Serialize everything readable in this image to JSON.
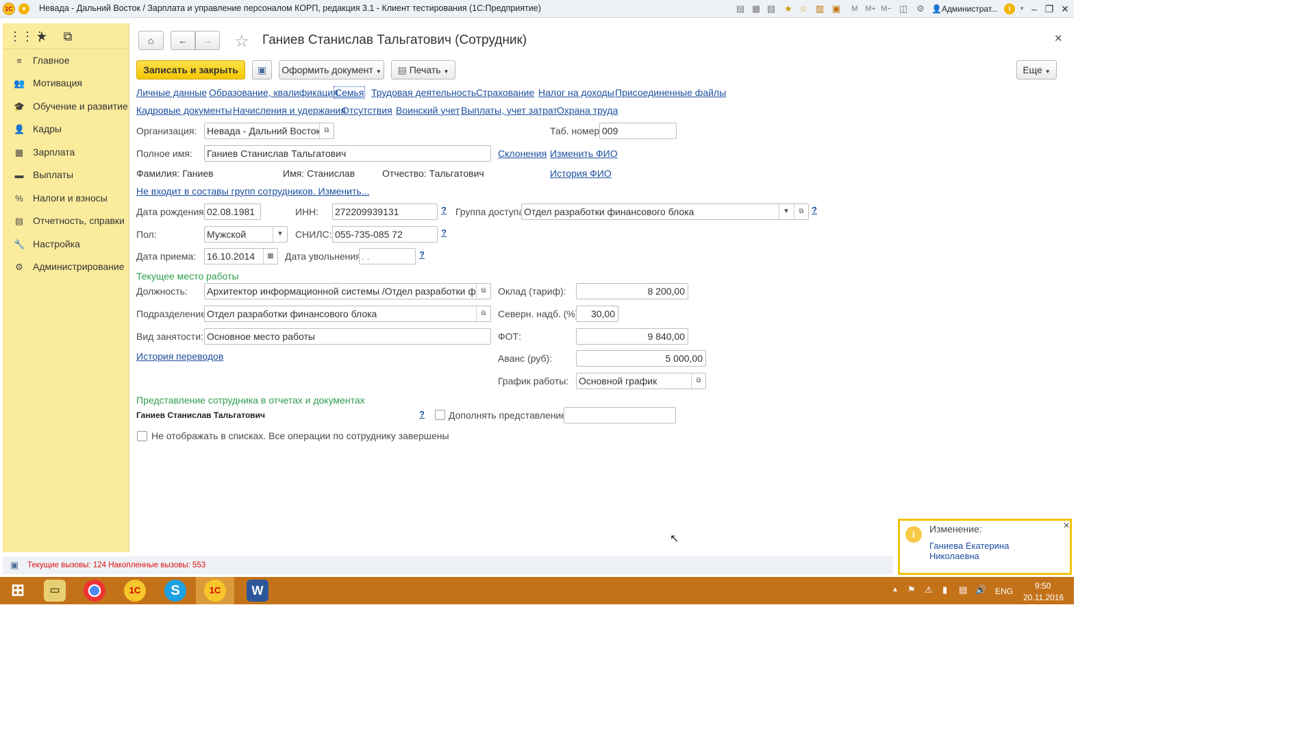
{
  "app": {
    "window_title": "Невада - Дальний Восток / Зарплата и управление персоналом КОРП, редакция 3.1  - Клиент тестирования (1С:Предприятие)",
    "user": "Администрат...",
    "logo": "1С"
  },
  "sidebar": {
    "items": [
      {
        "label": "Главное",
        "icon": "menu-lines-icon"
      },
      {
        "label": "Мотивация",
        "icon": "people-icon"
      },
      {
        "label": "Обучение и развитие",
        "icon": "graduation-icon"
      },
      {
        "label": "Кадры",
        "icon": "person-icon"
      },
      {
        "label": "Зарплата",
        "icon": "calculator-icon"
      },
      {
        "label": "Выплаты",
        "icon": "card-icon"
      },
      {
        "label": "Налоги и взносы",
        "icon": "percent-icon"
      },
      {
        "label": "Отчетность, справки",
        "icon": "report-icon"
      },
      {
        "label": "Настройка",
        "icon": "wrench-icon"
      },
      {
        "label": "Администрирование",
        "icon": "gear-icon"
      }
    ]
  },
  "form": {
    "title": "Ганиев Станислав Тальгатович (Сотрудник)",
    "toolbar": {
      "save_close": "Записать и закрыть",
      "make_document": "Оформить документ",
      "print": "Печать",
      "more": "Еще"
    },
    "tabs_row1": [
      "Личные данные",
      "Образование, квалификация",
      "Семья",
      "Трудовая деятельность",
      "Страхование",
      "Налог на доходы",
      "Присоединенные файлы"
    ],
    "tabs_row2": [
      "Кадровые документы",
      "Начисления и удержания",
      "Отсутствия",
      "Воинский учет",
      "Выплаты, учет затрат",
      "Охрана труда"
    ],
    "org_label": "Организация:",
    "org_value": "Невада - Дальний Восток",
    "tab_number_label": "Таб. номер:",
    "tab_number_value": "009",
    "fullname_label": "Полное имя:",
    "fullname_value": "Ганиев Станислав Тальгатович",
    "declensions_link": "Склонения",
    "change_fio_link": "Изменить ФИО",
    "surname": "Фамилия: Ганиев",
    "name": "Имя: Станислав",
    "patronymic": "Отчество: Тальгатович",
    "fio_history_link": "История ФИО",
    "groups_link": "Не входит в составы групп сотрудников. Изменить...",
    "birth_label": "Дата рождения:",
    "birth_value": "02.08.1981",
    "inn_label": "ИНН:",
    "inn_value": "272209939131",
    "access_label": "Группа доступа:",
    "access_value": "Отдел разработки финансового блока",
    "gender_label": "Пол:",
    "gender_value": "Мужской",
    "snils_label": "СНИЛС:",
    "snils_value": "055-735-085 72",
    "hire_label": "Дата приема:",
    "hire_value": "16.10.2014",
    "dismiss_label": "Дата увольнения:",
    "dismiss_value": " .  .",
    "help": "?",
    "current_section": "Текущее место работы",
    "position_label": "Должность:",
    "position_value": "Архитектор информационной системы /Отдел разработки финансового блока",
    "salary_label": "Оклад (тариф):",
    "salary_value": "8 200,00",
    "dept_label": "Подразделение:",
    "dept_value": "Отдел разработки финансового блока",
    "north_label": "Северн. надб. (%):",
    "north_value": "30,00",
    "emp_type_label": "Вид занятости:",
    "emp_type_value": "Основное место работы",
    "fot_label": "ФОТ:",
    "fot_value": "9 840,00",
    "transfers_link": "История переводов",
    "advance_label": "Аванс (руб):",
    "advance_value": "5 000,00",
    "schedule_label": "График работы:",
    "schedule_value": "Основной график",
    "repr_section": "Представление сотрудника в отчетах и документах",
    "repr_value": "Ганиев Станислав Тальгатович",
    "supplement_label": "Дополнять представление",
    "supplement_value": "",
    "hide_label": "Не отображать в списках. Все операции по сотруднику завершены"
  },
  "status": {
    "text": "Текущие вызовы: 124   Накопленные вызовы: 553"
  },
  "notification": {
    "title": "Изменение:",
    "link": "Ганиева Екатерина Николаевна"
  },
  "taskbar": {
    "lang": "ENG",
    "time": "9:50",
    "date": "20.11.2016"
  },
  "colors": {
    "sidebar_bg": "#fbec9d",
    "accent_yellow": "#f5c700",
    "link": "#1c4fa0",
    "section_green": "#2e9e4f",
    "taskbar": "#c4721a"
  }
}
